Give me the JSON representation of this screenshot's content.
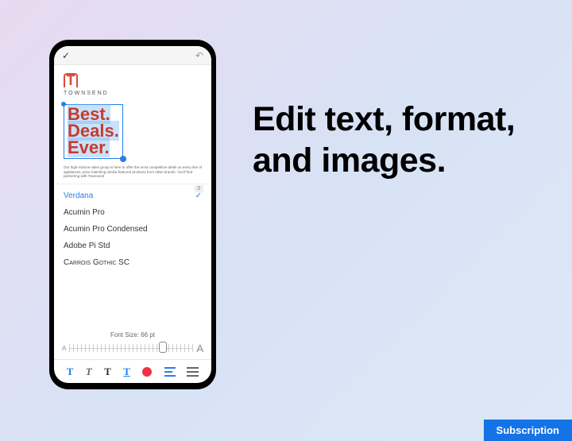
{
  "marketing_headline": "Edit text, format, and images.",
  "subscription_badge": "Subscription",
  "phone": {
    "brand": "TOWNSEND",
    "headline_lines": [
      "Best.",
      "Deals.",
      "Ever."
    ],
    "body_text": "Our high-volume sales group is here to offer the most competitive deals on every line of appliances, price matching similar featured products from other brands. You'll find partnering with Townsend",
    "page_indicator": "3",
    "fonts": [
      {
        "name": "Verdana",
        "selected": true
      },
      {
        "name": "Acumin Pro",
        "selected": false
      },
      {
        "name": "Acumin Pro Condensed",
        "selected": false
      },
      {
        "name": "Adobe Pi Std",
        "selected": false
      },
      {
        "name": "Carrois Gothic SC",
        "selected": false
      }
    ],
    "font_size_label": "Font Size: 66 pt",
    "slider_small": "A",
    "slider_large": "A",
    "toolbar": {
      "bold": "T",
      "italic": "T",
      "plain": "T",
      "underline": "T"
    }
  }
}
